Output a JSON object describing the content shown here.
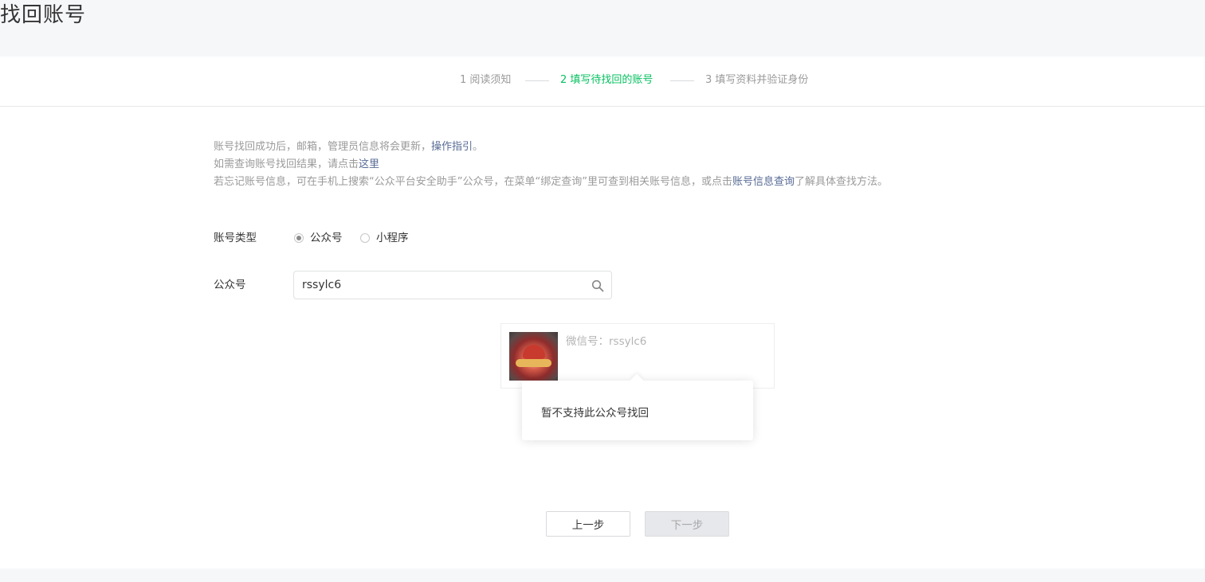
{
  "page": {
    "title": "找回账号"
  },
  "steps": [
    {
      "label": "1 阅读须知",
      "state": "done"
    },
    {
      "label": "2 填写待找回的账号",
      "state": "active"
    },
    {
      "label": "3 填写资料并验证身份",
      "state": "pending"
    }
  ],
  "notice": {
    "line1_text": "账号找回成功后，邮箱，管理员信息将会更新，",
    "line1_link": "操作指引",
    "line1_end": "。",
    "line2_text": "如需查询账号找回结果，请点击",
    "line2_link": "这里",
    "line3_text": "若忘记账号信息，可在手机上搜索“公众平台安全助手”公众号，在菜单“绑定查询”里可查到相关账号信息，或点击",
    "line3_link": "账号信息查询",
    "line3_end": "了解具体查找方法。"
  },
  "form": {
    "account_type_label": "账号类型",
    "options": [
      {
        "label": "公众号",
        "checked": true
      },
      {
        "label": "小程序",
        "checked": false
      }
    ],
    "account_label": "公众号",
    "search_value": "rssylc6",
    "search_icon": "search-icon"
  },
  "result": {
    "wechat_id": "微信号：rssylc6",
    "tooltip": "暂不支持此公众号找回"
  },
  "buttons": {
    "prev": "上一步",
    "next": "下一步"
  },
  "colors": {
    "accent": "#07c160",
    "link": "#576b95",
    "muted": "#9a9a9a"
  }
}
